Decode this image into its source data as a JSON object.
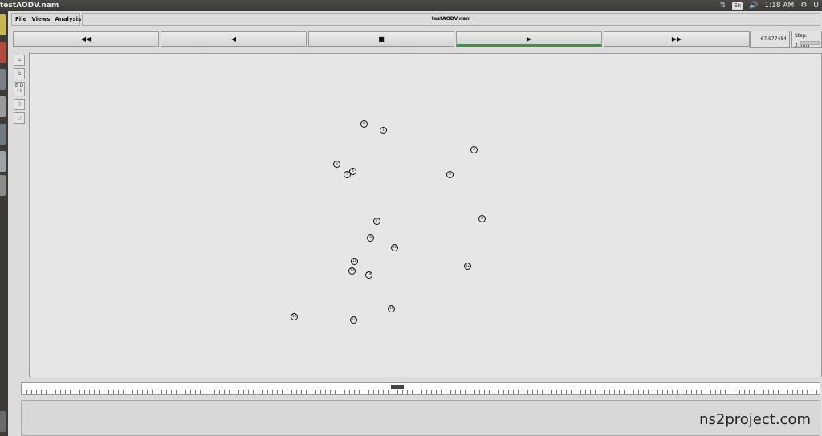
{
  "system": {
    "window_title": "testAODV.nam",
    "keyboard_layout": "En",
    "clock": "1:18 AM",
    "user_initial": "U"
  },
  "menu": {
    "items": [
      "File",
      "Views",
      "Analysis"
    ]
  },
  "title_field": "testAODV.nam",
  "controls": {
    "rewind": "◀◀",
    "back": "◀",
    "stop": "■",
    "play": "▶",
    "fast_forward": "▶▶"
  },
  "time_readout": "67.977454",
  "step_readout": "Step: 2.0ms",
  "tools": [
    "zoom-in",
    "zoom-out",
    "ED",
    "circle",
    "circle"
  ],
  "nodes": [
    "0",
    "1",
    "2",
    "3",
    "4",
    "5",
    "6",
    "7",
    "8",
    "9",
    "10",
    "11",
    "12",
    "13",
    "14",
    "15",
    "16",
    "17",
    "18",
    "19"
  ],
  "watermark": "ns2project.com",
  "colors": {
    "play_indicator": "#2e9a4c",
    "timeline_ticks": "#6a6fb8"
  }
}
